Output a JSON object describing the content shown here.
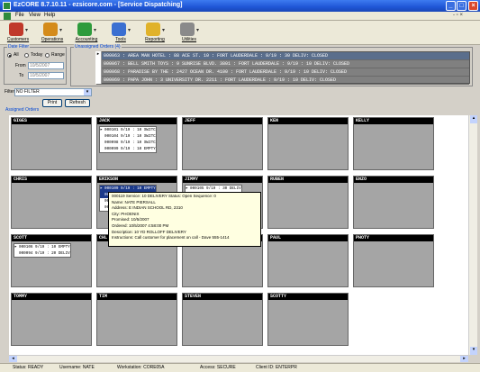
{
  "window": {
    "title": "EzCORE 8.7.10.11 - ezsicore.com - [Service Dispatching]",
    "min_label": "_",
    "max_label": "□",
    "close_label": "×"
  },
  "menu": {
    "items": [
      "File",
      "View",
      "Help"
    ],
    "mdi_controls": "- ▫ ×"
  },
  "toolbar": {
    "buttons": [
      {
        "label": "Customers",
        "color": "#c0392b"
      },
      {
        "label": "Operations",
        "color": "#d48b1a"
      },
      {
        "label": "Accounting",
        "color": "#2e9b3c"
      },
      {
        "label": "Tools",
        "color": "#3a6fd1"
      },
      {
        "label": "Reporting",
        "color": "#e0b22a"
      },
      {
        "label": "Utilities",
        "color": "#8a8a8a"
      }
    ]
  },
  "date_filter": {
    "legend": "Date Filter",
    "options": [
      "All",
      "Today",
      "Range"
    ],
    "selected": "All",
    "from_label": "From",
    "to_label": "To",
    "from_value": "10/5/2007",
    "to_value": "10/5/2007"
  },
  "filter": {
    "label": "Filter",
    "value": "NO FILTER",
    "print_label": "Print",
    "refresh_label": "Refresh"
  },
  "unassigned": {
    "legend": "Unassigned Orders (4)",
    "rows": [
      "000063 : AREA MAN HOTEL : 88 ACE ST. 10           : FORT LAUDERDALE : 9/19 : 30 DELIV: CLOSED",
      "000067 : BELL SMITH TOYS : 9 SUNRISE BLVD. 3801   : FORT LAUDERDALE : 9/19 : 10 DELIV: CLOSED",
      "000068 : PARADISE BY THE : 2427 OCEAN DR. 4100    : FORT LAUDERDALE : 9/19 : 10 DELIV: CLOSED",
      "000069 : PAPA JOHN       : 3 UNIVERSITY DR. 2211  : FORT LAUDERDALE : 9/19 : 10 DELIV: CLOSED"
    ]
  },
  "assigned_label": "Assigned Orders",
  "drivers": [
    {
      "name": "GIGES",
      "orders": []
    },
    {
      "name": "JACK",
      "orders": [
        "000101 9/19 : 10 SWITC",
        "000104 9/19 : 10 SWITC",
        "000098 9/19 : 10 SWITC",
        "000099 9/19 : 10 EMPTY"
      ]
    },
    {
      "name": "JEFF",
      "orders": []
    },
    {
      "name": "KEN",
      "orders": []
    },
    {
      "name": "KELLY",
      "orders": []
    },
    {
      "name": "CHRIS",
      "orders": []
    },
    {
      "name": "ERIKSON",
      "orders": [
        "000109 9/19 : 10 EMPTY",
        "000122 9/19 : 10 SWITC",
        "000111 10/3 : 20 DELIV",
        "000114 10/3 : 10 DELIV"
      ]
    },
    {
      "name": "JIMMY",
      "orders": [
        "000105 9/19 : 30 DELIV"
      ]
    },
    {
      "name": "RUBEN",
      "orders": []
    },
    {
      "name": "ENZO",
      "orders": []
    },
    {
      "name": "SCOTT",
      "orders": [
        "000106 9/19 : 10 EMPTY",
        "000094 9/19 : 20 DELIV"
      ]
    },
    {
      "name": "CHL",
      "orders": []
    },
    {
      "name": "",
      "orders": []
    },
    {
      "name": "PAUL",
      "orders": []
    },
    {
      "name": "PHOTY",
      "orders": []
    },
    {
      "name": "TOMMY",
      "orders": []
    },
    {
      "name": "TIM",
      "orders": []
    },
    {
      "name": "STEVEN",
      "orders": []
    },
    {
      "name": "SCOTTY",
      "orders": []
    }
  ],
  "tooltip": {
    "lines": [
      "000119 Service: 10 DELIVERY     Status: Open    Sequence: 0",
      "Name: NATE PIERSALL",
      "Address: E INDIAN SCHOOL RD, 2310",
      "City: PHOENIX",
      "Promised: 10/5/2007",
      "Ordered: 10/5/2007 4:58:00 PM",
      "Description: 10 YD ROLLOFF DELIVERY",
      "Instructions: Call customer for placement on call - Dave 555-1414"
    ]
  },
  "status": {
    "status": "Status: READY",
    "username": "Username: NATE",
    "workstation": "Workstation: CORE05A",
    "access": "Access: SECURE",
    "client": "Client ID: ENTERPR"
  }
}
